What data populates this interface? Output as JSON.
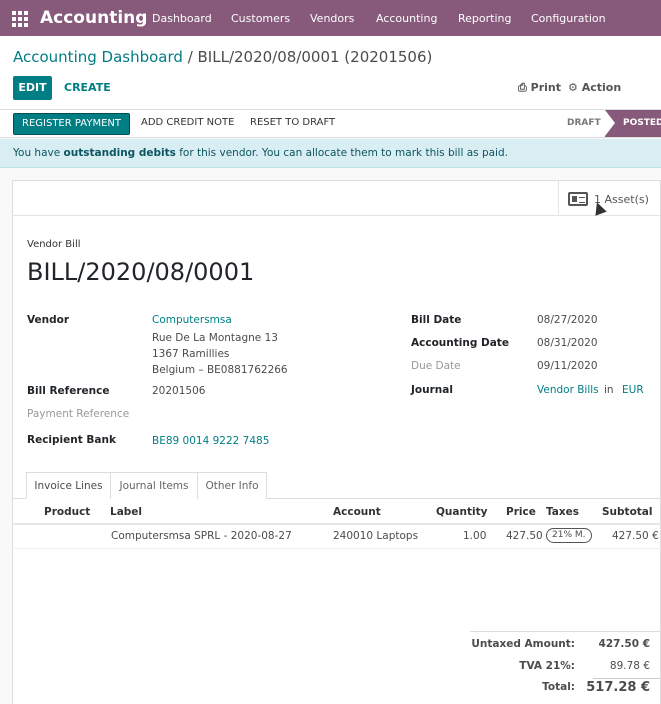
{
  "navbar": {
    "brand": "Accounting",
    "menu": [
      "Dashboard",
      "Customers",
      "Vendors",
      "Accounting",
      "Reporting",
      "Configuration"
    ]
  },
  "breadcrumb": {
    "parent": "Accounting Dashboard",
    "separator": " / ",
    "current": "BILL/2020/08/0001 (20201506)"
  },
  "actions": {
    "edit": "EDIT",
    "create": "CREATE",
    "print": "Print",
    "action": "Action"
  },
  "statusbar": {
    "register_payment": "REGISTER PAYMENT",
    "add_credit_note": "ADD CREDIT NOTE",
    "reset_to_draft": "RESET TO DRAFT",
    "stage_draft": "DRAFT",
    "stage_posted": "POSTED"
  },
  "alert": {
    "prefix": "You have ",
    "bold": "outstanding debits",
    "suffix": " for this vendor. You can allocate them to mark this bill as paid."
  },
  "smart_button": {
    "label": "1 Asset(s)"
  },
  "bill": {
    "type_label": "Vendor Bill",
    "number": "BILL/2020/08/0001"
  },
  "fields_left": {
    "vendor_label": "Vendor",
    "vendor_name": "Computersmsa",
    "address_1": "Rue De La Montagne 13",
    "address_2": "1367 Ramillies",
    "address_3": "Belgium – BE0881762266",
    "bill_reference_label": "Bill Reference",
    "bill_reference": "20201506",
    "payment_reference_label": "Payment Reference",
    "recipient_bank_label": "Recipient Bank",
    "recipient_bank": "BE89 0014 9222 7485"
  },
  "fields_right": {
    "bill_date_label": "Bill Date",
    "bill_date": "08/27/2020",
    "accounting_date_label": "Accounting Date",
    "accounting_date": "08/31/2020",
    "due_date_label": "Due Date",
    "due_date": "09/11/2020",
    "journal_label": "Journal",
    "journal": "Vendor Bills",
    "journal_in": "in",
    "currency": "EUR"
  },
  "tabs": [
    "Invoice Lines",
    "Journal Items",
    "Other Info"
  ],
  "lines": {
    "headers": [
      "Product",
      "Label",
      "Account",
      "Quantity",
      "Price",
      "Taxes",
      "Subtotal"
    ],
    "rows": [
      {
        "product": "",
        "label": "Computersmsa SPRL  - 2020-08-27",
        "account": "240010 Laptops",
        "quantity": "1.00",
        "price": "427.50",
        "taxes": "21% M.",
        "subtotal": "427.50 €"
      }
    ]
  },
  "totals": {
    "untaxed_label": "Untaxed Amount:",
    "untaxed": "427.50 €",
    "tva_label": "TVA 21%:",
    "tva": "89.78 €",
    "total_label": "Total:",
    "total": "517.28 €"
  },
  "colors": {
    "navbar": "#875a7b",
    "primary": "#017e84",
    "alert_bg": "#d9eef2"
  }
}
